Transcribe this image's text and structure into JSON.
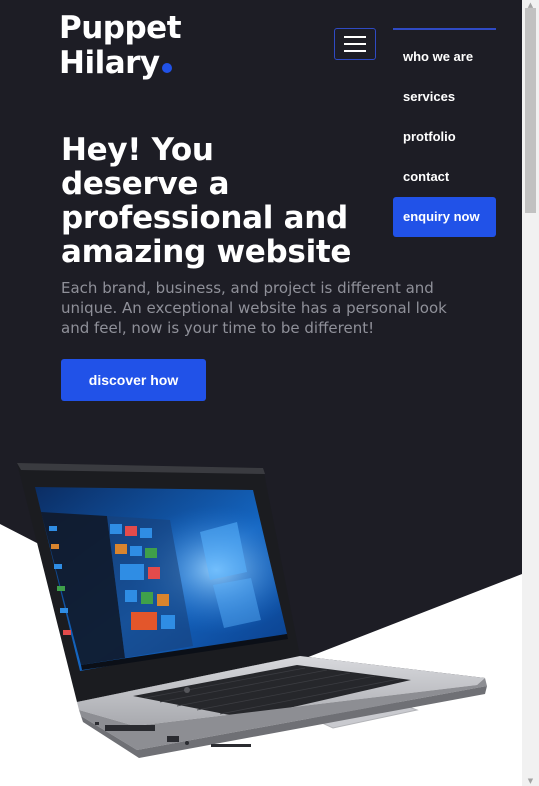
{
  "brand": {
    "line1": "Puppet",
    "line2": "Hilary",
    "accent_color": "#2152e8"
  },
  "nav": {
    "items": [
      {
        "label": "who we are"
      },
      {
        "label": "services"
      },
      {
        "label": "protfolio"
      },
      {
        "label": "contact"
      }
    ],
    "cta_label": "enquiry now",
    "menu_icon": "hamburger-menu-icon"
  },
  "hero": {
    "headline": "Hey! You deserve a professional and amazing website",
    "subtext": "Each brand, business, and project is different and unique. An exceptional website has a personal look and feel, now is your time to be different!",
    "button_label": "discover how"
  },
  "colors": {
    "background": "#1d1d25",
    "accent": "#2152e8",
    "muted_text": "#8f9099"
  }
}
